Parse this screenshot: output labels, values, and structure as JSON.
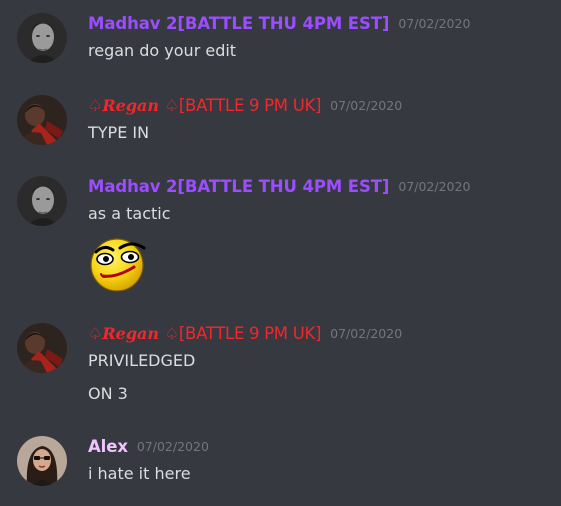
{
  "colors": {
    "background": "#36393f",
    "madhav_name": "#9b4dff",
    "regan_name": "#f4262b",
    "alex_name": "#f1c3ff",
    "timestamp": "#72767d",
    "message_text": "#dcddde"
  },
  "messages": [
    {
      "author": "Madhav 2[BATTLE THU 4PM EST]",
      "timestamp": "07/02/2020",
      "avatar": "madhav-avatar",
      "lines": [
        "regan do your edit"
      ]
    },
    {
      "author_prefix": "♤Regan ♤",
      "author_suffix": "[BATTLE 9 PM UK]",
      "timestamp": "07/02/2020",
      "avatar": "regan-avatar",
      "lines": [
        "TYPE IN"
      ]
    },
    {
      "author": "Madhav 2[BATTLE THU 4PM EST]",
      "timestamp": "07/02/2020",
      "avatar": "madhav-avatar",
      "lines": [
        "as a tactic"
      ],
      "emoji": "smirk-emoji"
    },
    {
      "author_prefix": "♤Regan ♤",
      "author_suffix": "[BATTLE 9 PM UK]",
      "timestamp": "07/02/2020",
      "avatar": "regan-avatar",
      "lines": [
        "PRIVILEDGED",
        "ON 3"
      ]
    },
    {
      "author": "Alex",
      "timestamp": "07/02/2020",
      "avatar": "alex-avatar",
      "lines": [
        "i hate it here"
      ]
    }
  ]
}
